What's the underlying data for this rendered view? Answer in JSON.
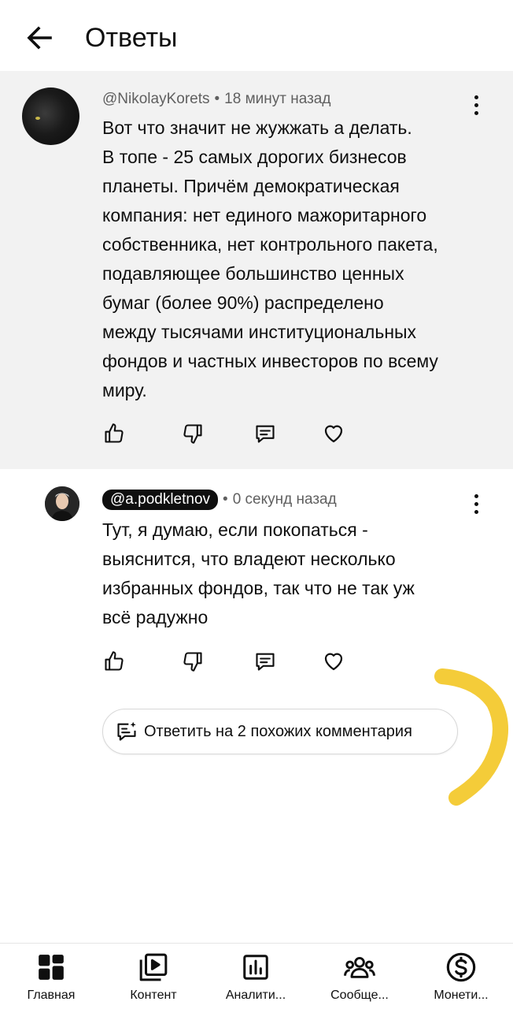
{
  "header": {
    "title": "Ответы"
  },
  "parent_comment": {
    "handle": "@NikolayKorets",
    "time": "18 минут назад",
    "text": "Вот что значит не жужжать а делать.\nВ топе - 25 самых дорогих бизнесов\nпланеты. Причём демократическая\nкомпания: нет единого мажоритарного\nсобственника, нет контрольного пакета,\nподавляющее большинство ценных\nбумаг (более 90%) распределено\nмежду тысячами институциональных\nфондов и частных инвесторов по всему\nмиру."
  },
  "reply_comment": {
    "handle": "@a.podkletnov",
    "time": "0 секунд назад",
    "text": "Тут, я думаю, если покопаться -\nвыяснится, что владеют несколько\nизбранных фондов, так что не так уж\nвсё радужно"
  },
  "similar_button": {
    "label": "Ответить на 2 похожих комментария"
  },
  "bottom_nav": [
    {
      "label": "Главная",
      "icon": "home-grid-icon"
    },
    {
      "label": "Контент",
      "icon": "content-library-icon"
    },
    {
      "label": "Аналити...",
      "icon": "analytics-icon"
    },
    {
      "label": "Сообще...",
      "icon": "community-icon"
    },
    {
      "label": "Монети...",
      "icon": "monetization-icon"
    }
  ],
  "colors": {
    "highlight_stroke": "#f3c623",
    "parent_bg": "#f2f2f2",
    "text": "#0f0f0f",
    "muted": "#606060"
  }
}
